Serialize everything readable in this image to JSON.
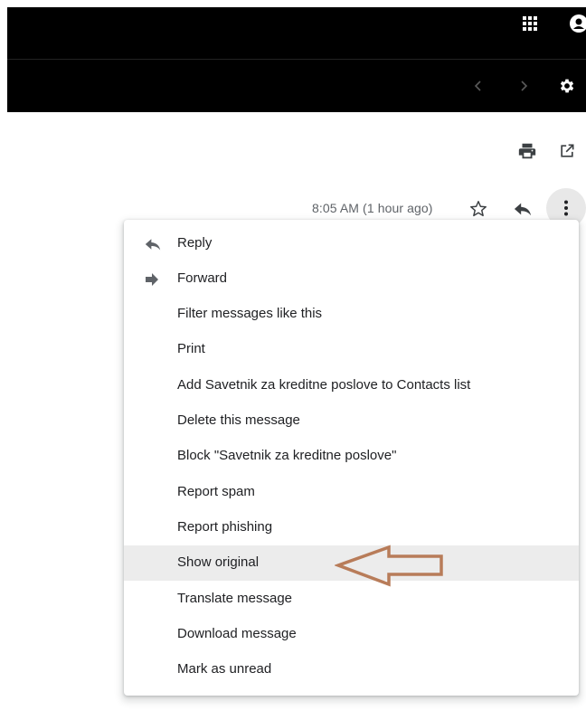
{
  "colors": {
    "topbar": "#000000",
    "menu_highlight": "#ececec",
    "annotation_arrow": "#b87c59",
    "icon": "#5f6368"
  },
  "icons": {
    "apps": "grid-icon",
    "account": "account-icon",
    "older": "chevron-left-icon",
    "newer": "chevron-right-icon",
    "settings": "gear-icon",
    "print_all": "printer-icon",
    "new_window": "open-in-new-icon",
    "star": "star-icon",
    "reply": "reply-icon",
    "more": "more-vert-icon"
  },
  "message": {
    "timestamp": "8:05 AM (1 hour ago)"
  },
  "menu": {
    "items": [
      {
        "label": "Reply",
        "icon": "reply-icon"
      },
      {
        "label": "Forward",
        "icon": "forward-icon"
      },
      {
        "label": "Filter messages like this"
      },
      {
        "label": "Print"
      },
      {
        "label": "Add Savetnik za kreditne poslove to Contacts list"
      },
      {
        "label": "Delete this message"
      },
      {
        "label": "Block \"Savetnik za kreditne poslove\""
      },
      {
        "label": "Report spam"
      },
      {
        "label": "Report phishing"
      },
      {
        "label": "Show original",
        "highlighted": true
      },
      {
        "label": "Translate message"
      },
      {
        "label": "Download message"
      },
      {
        "label": "Mark as unread"
      }
    ]
  }
}
